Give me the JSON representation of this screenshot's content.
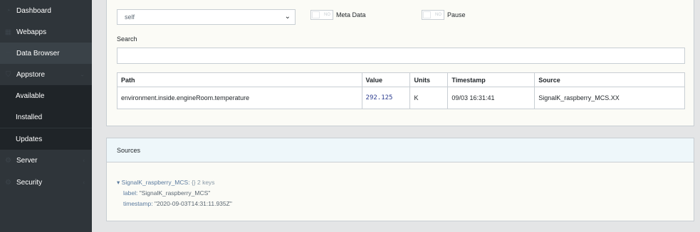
{
  "sidebar": {
    "items": [
      {
        "label": "Dashboard",
        "icon": "speedometer-icon"
      },
      {
        "label": "Webapps",
        "icon": "grid-icon"
      },
      {
        "label": "Data Browser",
        "icon": "folder-icon"
      },
      {
        "label": "Appstore",
        "icon": "cart-icon"
      },
      {
        "label": "Server",
        "icon": "gear-icon"
      },
      {
        "label": "Security",
        "icon": "gear-icon"
      }
    ],
    "appstore_sub": [
      {
        "label": "Available"
      },
      {
        "label": "Installed"
      },
      {
        "label": "Updates"
      }
    ]
  },
  "browser": {
    "context_value": "self",
    "meta_toggle": {
      "state": "NO",
      "label": "Meta Data"
    },
    "pause_toggle": {
      "state": "NO",
      "label": "Pause"
    },
    "search_label": "Search",
    "search_value": "",
    "table": {
      "headers": [
        "Path",
        "Value",
        "Units",
        "Timestamp",
        "Source"
      ],
      "rows": [
        {
          "path": "environment.inside.engineRoom.temperature",
          "value": "292.125",
          "units": "K",
          "timestamp": "09/03 16:31:41",
          "source": "SignalK_raspberry_MCS.XX"
        }
      ]
    }
  },
  "sources": {
    "title": "Sources",
    "root_key": "SignalK_raspberry_MCS:",
    "root_meta": "{}  2 keys",
    "fields": [
      {
        "key": "label:",
        "value": "\"SignalK_raspberry_MCS\""
      },
      {
        "key": "timestamp:",
        "value": "\"2020-09-03T14:31:11.935Z\""
      }
    ]
  },
  "colors": {
    "sidebar": "#2f353a",
    "sidebar_sub": "#1f2428",
    "card_bg": "#fbfbf6",
    "sources_header": "#eef7fa"
  }
}
